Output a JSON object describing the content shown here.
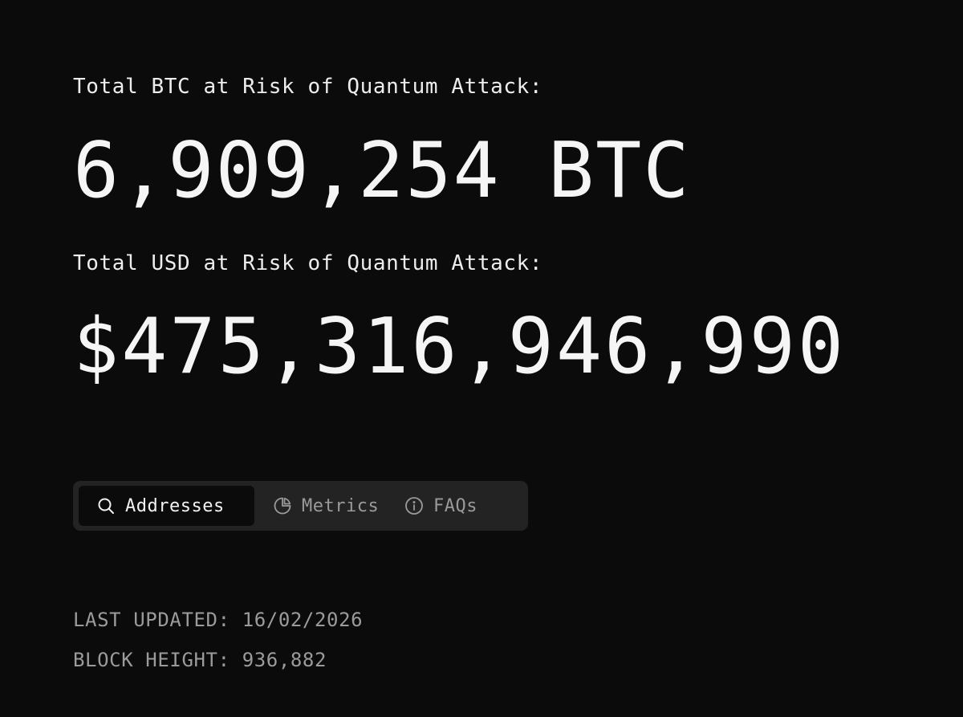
{
  "btc": {
    "label": "Total BTC at Risk of Quantum Attack:",
    "value": "6,909,254 BTC"
  },
  "usd": {
    "label": "Total USD at Risk of Quantum Attack:",
    "value": "$475,316,946,990"
  },
  "tabs": [
    {
      "label": "Addresses",
      "icon": "search-icon",
      "active": true
    },
    {
      "label": "Metrics",
      "icon": "pie-chart-icon",
      "active": false
    },
    {
      "label": "FAQs",
      "icon": "info-icon",
      "active": false
    }
  ],
  "meta": {
    "last_updated": "LAST UPDATED: 16/02/2026",
    "block_height": "BLOCK HEIGHT: 936,882"
  },
  "colors": {
    "background": "#0b0b0b",
    "text": "#f2f2f2",
    "muted": "#9a9a9a",
    "tab_bar": "#232323"
  }
}
